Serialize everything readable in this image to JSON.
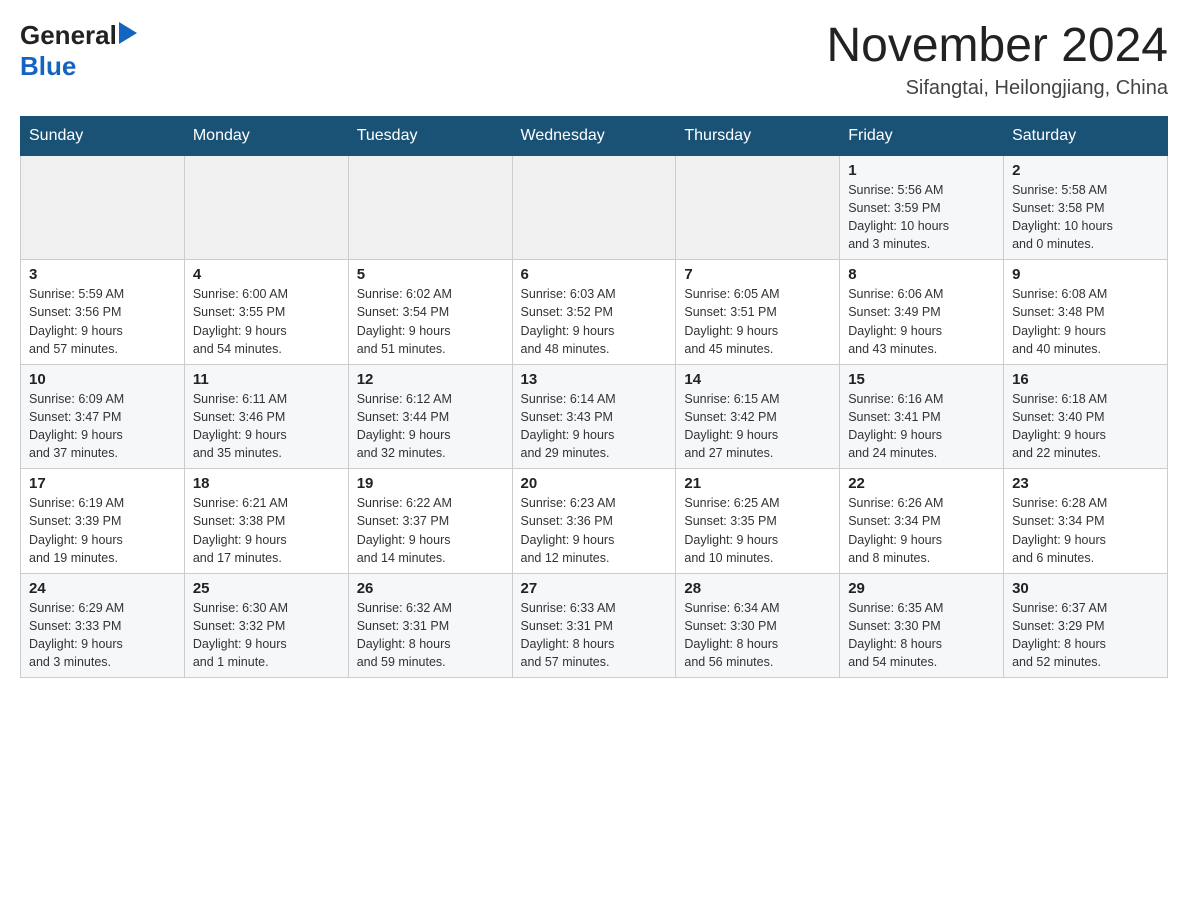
{
  "header": {
    "logo_general": "General",
    "logo_blue": "Blue",
    "month_title": "November 2024",
    "location": "Sifangtai, Heilongjiang, China"
  },
  "days_of_week": [
    "Sunday",
    "Monday",
    "Tuesday",
    "Wednesday",
    "Thursday",
    "Friday",
    "Saturday"
  ],
  "weeks": [
    [
      {
        "day": "",
        "info": ""
      },
      {
        "day": "",
        "info": ""
      },
      {
        "day": "",
        "info": ""
      },
      {
        "day": "",
        "info": ""
      },
      {
        "day": "",
        "info": ""
      },
      {
        "day": "1",
        "info": "Sunrise: 5:56 AM\nSunset: 3:59 PM\nDaylight: 10 hours\nand 3 minutes."
      },
      {
        "day": "2",
        "info": "Sunrise: 5:58 AM\nSunset: 3:58 PM\nDaylight: 10 hours\nand 0 minutes."
      }
    ],
    [
      {
        "day": "3",
        "info": "Sunrise: 5:59 AM\nSunset: 3:56 PM\nDaylight: 9 hours\nand 57 minutes."
      },
      {
        "day": "4",
        "info": "Sunrise: 6:00 AM\nSunset: 3:55 PM\nDaylight: 9 hours\nand 54 minutes."
      },
      {
        "day": "5",
        "info": "Sunrise: 6:02 AM\nSunset: 3:54 PM\nDaylight: 9 hours\nand 51 minutes."
      },
      {
        "day": "6",
        "info": "Sunrise: 6:03 AM\nSunset: 3:52 PM\nDaylight: 9 hours\nand 48 minutes."
      },
      {
        "day": "7",
        "info": "Sunrise: 6:05 AM\nSunset: 3:51 PM\nDaylight: 9 hours\nand 45 minutes."
      },
      {
        "day": "8",
        "info": "Sunrise: 6:06 AM\nSunset: 3:49 PM\nDaylight: 9 hours\nand 43 minutes."
      },
      {
        "day": "9",
        "info": "Sunrise: 6:08 AM\nSunset: 3:48 PM\nDaylight: 9 hours\nand 40 minutes."
      }
    ],
    [
      {
        "day": "10",
        "info": "Sunrise: 6:09 AM\nSunset: 3:47 PM\nDaylight: 9 hours\nand 37 minutes."
      },
      {
        "day": "11",
        "info": "Sunrise: 6:11 AM\nSunset: 3:46 PM\nDaylight: 9 hours\nand 35 minutes."
      },
      {
        "day": "12",
        "info": "Sunrise: 6:12 AM\nSunset: 3:44 PM\nDaylight: 9 hours\nand 32 minutes."
      },
      {
        "day": "13",
        "info": "Sunrise: 6:14 AM\nSunset: 3:43 PM\nDaylight: 9 hours\nand 29 minutes."
      },
      {
        "day": "14",
        "info": "Sunrise: 6:15 AM\nSunset: 3:42 PM\nDaylight: 9 hours\nand 27 minutes."
      },
      {
        "day": "15",
        "info": "Sunrise: 6:16 AM\nSunset: 3:41 PM\nDaylight: 9 hours\nand 24 minutes."
      },
      {
        "day": "16",
        "info": "Sunrise: 6:18 AM\nSunset: 3:40 PM\nDaylight: 9 hours\nand 22 minutes."
      }
    ],
    [
      {
        "day": "17",
        "info": "Sunrise: 6:19 AM\nSunset: 3:39 PM\nDaylight: 9 hours\nand 19 minutes."
      },
      {
        "day": "18",
        "info": "Sunrise: 6:21 AM\nSunset: 3:38 PM\nDaylight: 9 hours\nand 17 minutes."
      },
      {
        "day": "19",
        "info": "Sunrise: 6:22 AM\nSunset: 3:37 PM\nDaylight: 9 hours\nand 14 minutes."
      },
      {
        "day": "20",
        "info": "Sunrise: 6:23 AM\nSunset: 3:36 PM\nDaylight: 9 hours\nand 12 minutes."
      },
      {
        "day": "21",
        "info": "Sunrise: 6:25 AM\nSunset: 3:35 PM\nDaylight: 9 hours\nand 10 minutes."
      },
      {
        "day": "22",
        "info": "Sunrise: 6:26 AM\nSunset: 3:34 PM\nDaylight: 9 hours\nand 8 minutes."
      },
      {
        "day": "23",
        "info": "Sunrise: 6:28 AM\nSunset: 3:34 PM\nDaylight: 9 hours\nand 6 minutes."
      }
    ],
    [
      {
        "day": "24",
        "info": "Sunrise: 6:29 AM\nSunset: 3:33 PM\nDaylight: 9 hours\nand 3 minutes."
      },
      {
        "day": "25",
        "info": "Sunrise: 6:30 AM\nSunset: 3:32 PM\nDaylight: 9 hours\nand 1 minute."
      },
      {
        "day": "26",
        "info": "Sunrise: 6:32 AM\nSunset: 3:31 PM\nDaylight: 8 hours\nand 59 minutes."
      },
      {
        "day": "27",
        "info": "Sunrise: 6:33 AM\nSunset: 3:31 PM\nDaylight: 8 hours\nand 57 minutes."
      },
      {
        "day": "28",
        "info": "Sunrise: 6:34 AM\nSunset: 3:30 PM\nDaylight: 8 hours\nand 56 minutes."
      },
      {
        "day": "29",
        "info": "Sunrise: 6:35 AM\nSunset: 3:30 PM\nDaylight: 8 hours\nand 54 minutes."
      },
      {
        "day": "30",
        "info": "Sunrise: 6:37 AM\nSunset: 3:29 PM\nDaylight: 8 hours\nand 52 minutes."
      }
    ]
  ]
}
